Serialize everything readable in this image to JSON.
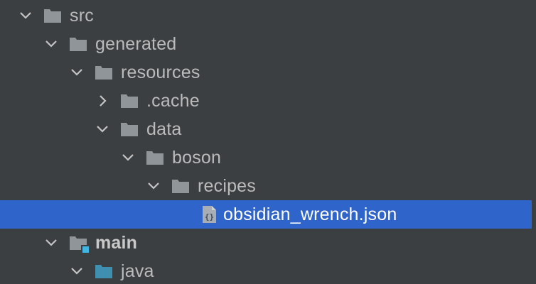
{
  "tree": {
    "rows": [
      {
        "label": "src",
        "expanded": true,
        "icon": "folder-icon"
      },
      {
        "label": "generated",
        "expanded": true,
        "icon": "folder-icon"
      },
      {
        "label": "resources",
        "expanded": true,
        "icon": "folder-icon"
      },
      {
        "label": ".cache",
        "expanded": false,
        "icon": "folder-icon"
      },
      {
        "label": "data",
        "expanded": true,
        "icon": "folder-icon"
      },
      {
        "label": "boson",
        "expanded": true,
        "icon": "folder-icon"
      },
      {
        "label": "recipes",
        "expanded": true,
        "icon": "folder-icon"
      },
      {
        "label": "obsidian_wrench.json",
        "selected": true,
        "icon": "json-file-icon"
      },
      {
        "label": "main",
        "expanded": true,
        "icon": "source-set-folder-icon"
      },
      {
        "label": "java",
        "expanded": true,
        "icon": "source-root-folder-icon"
      }
    ]
  },
  "colors": {
    "background": "#3c3f41",
    "selection": "#2f65ca",
    "folder": "#8f9598",
    "source_root": "#3f8fb0",
    "text": "#bbbbbb"
  }
}
